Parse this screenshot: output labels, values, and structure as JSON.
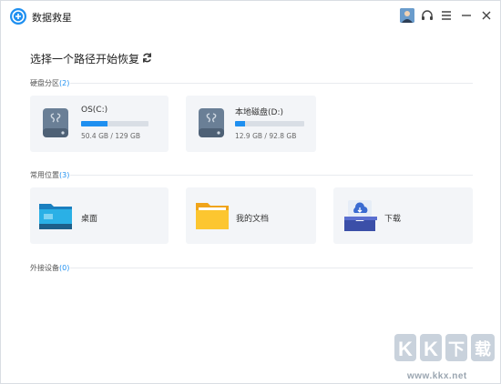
{
  "app": {
    "title": "数据救星"
  },
  "titlebar": {
    "avatar_icon": "user-avatar",
    "support_icon": "headset-icon",
    "menu_icon": "menu-icon",
    "minimize_icon": "minimize-icon",
    "close_icon": "close-icon"
  },
  "main": {
    "heading": "选择一个路径开始恢复",
    "refresh_icon": "refresh-icon"
  },
  "partitions": {
    "label": "硬盘分区",
    "count": "(2)",
    "drives": [
      {
        "name": "OS(C:)",
        "size_text": "50.4 GB / 129 GB",
        "used_fraction": 0.39
      },
      {
        "name": "本地磁盘(D:)",
        "size_text": "12.9 GB / 92.8 GB",
        "used_fraction": 0.14
      }
    ]
  },
  "locations": {
    "label": "常用位置",
    "count": "(3)",
    "items": [
      {
        "name": "桌面",
        "icon": "desktop-folder-icon"
      },
      {
        "name": "我的文档",
        "icon": "documents-folder-icon"
      },
      {
        "name": "下载",
        "icon": "download-tray-icon"
      }
    ]
  },
  "external": {
    "label": "外接设备",
    "count": "(0)"
  },
  "watermark": {
    "logo_text": "KK下载",
    "url": "www.kkx.net"
  },
  "colors": {
    "accent": "#1e8ff0",
    "card_bg": "#f3f5f8"
  }
}
